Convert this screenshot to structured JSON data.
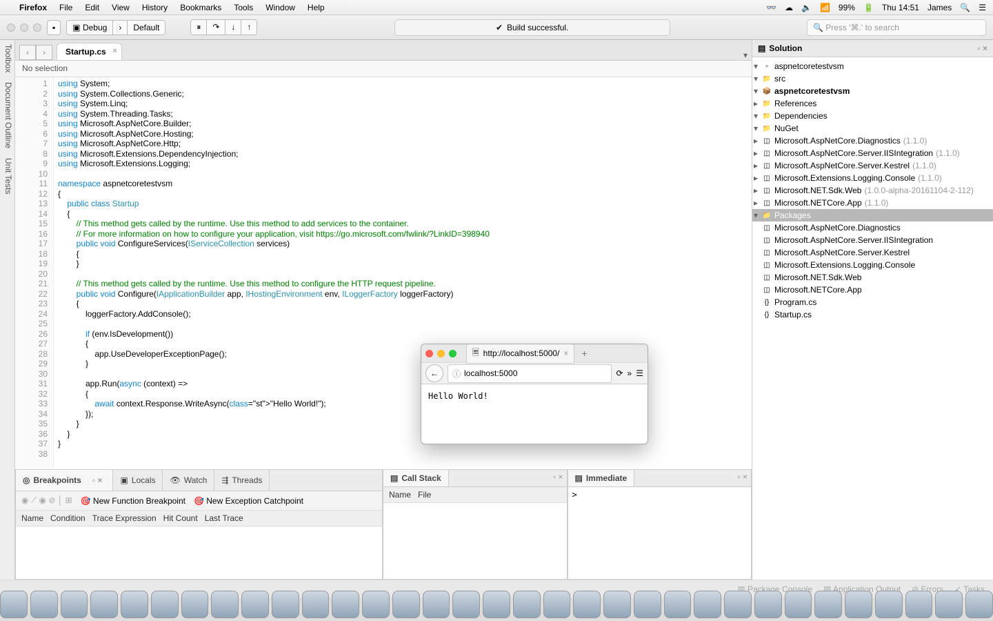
{
  "menubar": {
    "app": "Firefox",
    "items": [
      "File",
      "Edit",
      "View",
      "History",
      "Bookmarks",
      "Tools",
      "Window",
      "Help"
    ],
    "battery": "99%",
    "clock": "Thu 14:51",
    "user": "James"
  },
  "toolbar": {
    "config": "Debug",
    "target": "Default",
    "status": "Build successful.",
    "search_placeholder": "Press '⌘.' to search"
  },
  "tab": {
    "name": "Startup.cs"
  },
  "breadcrumb": "No selection",
  "code_lines": [
    "using System;",
    "using System.Collections.Generic;",
    "using System.Linq;",
    "using System.Threading.Tasks;",
    "using Microsoft.AspNetCore.Builder;",
    "using Microsoft.AspNetCore.Hosting;",
    "using Microsoft.AspNetCore.Http;",
    "using Microsoft.Extensions.DependencyInjection;",
    "using Microsoft.Extensions.Logging;",
    "",
    "namespace aspnetcoretestvsm",
    "{",
    "    public class Startup",
    "    {",
    "        // This method gets called by the runtime. Use this method to add services to the container.",
    "        // For more information on how to configure your application, visit https://go.microsoft.com/fwlink/?LinkID=398940",
    "        public void ConfigureServices(IServiceCollection services)",
    "        {",
    "        }",
    "",
    "        // This method gets called by the runtime. Use this method to configure the HTTP request pipeline.",
    "        public void Configure(IApplicationBuilder app, IHostingEnvironment env, ILoggerFactory loggerFactory)",
    "        {",
    "            loggerFactory.AddConsole();",
    "",
    "            if (env.IsDevelopment())",
    "            {",
    "                app.UseDeveloperExceptionPage();",
    "            }",
    "",
    "            app.Run(async (context) =>",
    "            {",
    "                await context.Response.WriteAsync(\"Hello World!\");",
    "            });",
    "        }",
    "    }",
    "}",
    ""
  ],
  "leftrail": [
    "Toolbox",
    "Document Outline",
    "Unit Tests"
  ],
  "solution": {
    "title": "Solution",
    "root": "aspnetcoretestvsm",
    "src": "src",
    "project": "aspnetcoretestvsm",
    "refs": "References",
    "deps": "Dependencies",
    "nuget": "NuGet",
    "nuget_items": [
      {
        "name": "Microsoft.AspNetCore.Diagnostics",
        "ver": "(1.1.0)"
      },
      {
        "name": "Microsoft.AspNetCore.Server.IISIntegration",
        "ver": "(1.1.0)"
      },
      {
        "name": "Microsoft.AspNetCore.Server.Kestrel",
        "ver": "(1.1.0)"
      },
      {
        "name": "Microsoft.Extensions.Logging.Console",
        "ver": "(1.1.0)"
      },
      {
        "name": "Microsoft.NET.Sdk.Web",
        "ver": "(1.0.0-alpha-20161104-2-112)"
      },
      {
        "name": "Microsoft.NETCore.App",
        "ver": "(1.1.0)"
      }
    ],
    "packages": "Packages",
    "package_items": [
      "Microsoft.AspNetCore.Diagnostics",
      "Microsoft.AspNetCore.Server.IISIntegration",
      "Microsoft.AspNetCore.Server.Kestrel",
      "Microsoft.Extensions.Logging.Console",
      "Microsoft.NET.Sdk.Web",
      "Microsoft.NETCore.App"
    ],
    "files": [
      "Program.cs",
      "Startup.cs"
    ]
  },
  "bottom": {
    "bp_tabs": [
      "Breakpoints",
      "Locals",
      "Watch",
      "Threads"
    ],
    "bp_new_func": "New Function Breakpoint",
    "bp_new_exc": "New Exception Catchpoint",
    "bp_cols": [
      "Name",
      "Condition",
      "Trace Expression",
      "Hit Count",
      "Last Trace"
    ],
    "cs_title": "Call Stack",
    "cs_cols": [
      "Name",
      "File"
    ],
    "im_title": "Immediate",
    "im_prompt": ">"
  },
  "statusbar": [
    "Package Console",
    "Application Output",
    "Errors",
    "Tasks"
  ],
  "browser": {
    "tab": "http://localhost:5000/",
    "url": "localhost:5000",
    "body": "Hello World!"
  }
}
